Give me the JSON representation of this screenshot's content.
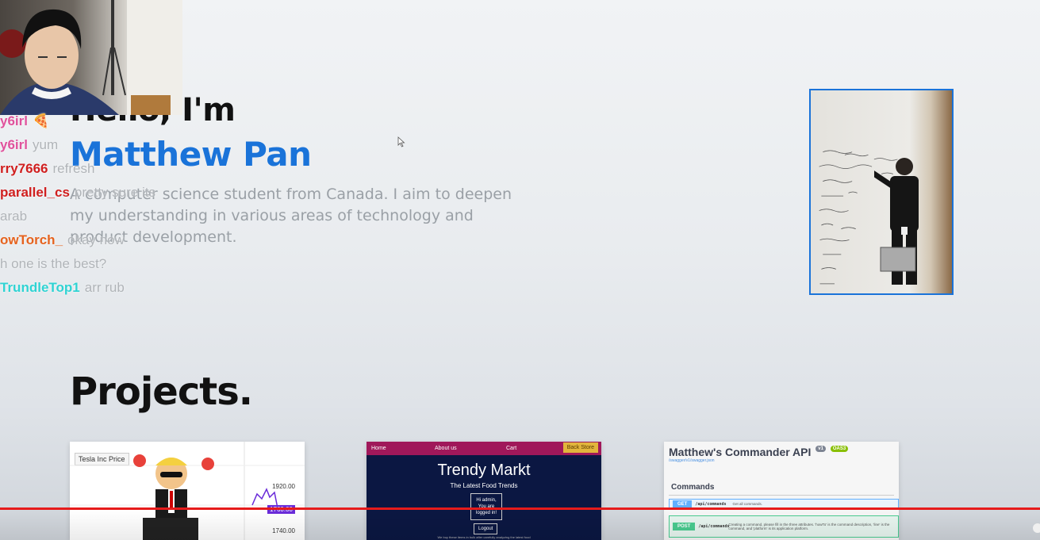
{
  "hero": {
    "greeting": "Hello, I'm",
    "name": "Matthew Pan",
    "bio": "A computer science student from Canada. I aim to deepen my understanding in various areas of technology and product development."
  },
  "projects": {
    "heading": "Projects.",
    "cards": [
      {
        "id": "stock",
        "title": "Tesla Inc Price",
        "price_labels": [
          "1920.00",
          "1760.00",
          "1740.00"
        ]
      },
      {
        "id": "trendy",
        "nav": [
          "Home",
          "About us",
          "Cart",
          "Back Store"
        ],
        "title": "Trendy Markt",
        "subtitle": "The Latest Food Trends",
        "greeting_lines": [
          "Hi admin,",
          "You are",
          "logged in!"
        ],
        "logout": "Logout",
        "footer": "We buy these items in bulk after carefully analyzing the latest food"
      },
      {
        "id": "api",
        "title": "Matthew's Commander API",
        "version_badge": "v1",
        "oas_badge": "OAS3",
        "link": "/swagger/v1/swagger.json",
        "section": "Commands",
        "endpoints": [
          {
            "method": "GET",
            "path": "/api/commands",
            "desc": "Get all commands."
          },
          {
            "method": "POST",
            "path": "/api/commands",
            "desc": "Creating a command, please fill in the three attributes. 'howTo' is the command description, 'line' is the command, and 'platform' is its application platform."
          }
        ]
      }
    ]
  },
  "chat": [
    {
      "user": "y6irl",
      "msg": "🍕",
      "color": "#e0529c"
    },
    {
      "user": "y6irl",
      "msg": "yum",
      "color": "#e0529c"
    },
    {
      "user": "rry7666",
      "msg": "refresh",
      "color": "#d01f1f"
    },
    {
      "user": "parallel_cs",
      "msg": "pretty sure its",
      "color": "#d01f1f"
    },
    {
      "user": "",
      "msg": "arab",
      "color": "#888"
    },
    {
      "user": "owTorch_",
      "msg": "okay now",
      "color": "#e5631f"
    },
    {
      "user": "",
      "msg": "h one is the best?",
      "color": "#888"
    },
    {
      "user": "TrundleTop1",
      "msg": "arr rub",
      "color": "#2fd3d3"
    }
  ],
  "icons": {
    "cursor": "mouse-pointer-icon",
    "webcam": "webcam-feed",
    "photo": "profile-photo"
  },
  "colors": {
    "accent": "#1a73d9",
    "progress": "#e61b1b"
  }
}
